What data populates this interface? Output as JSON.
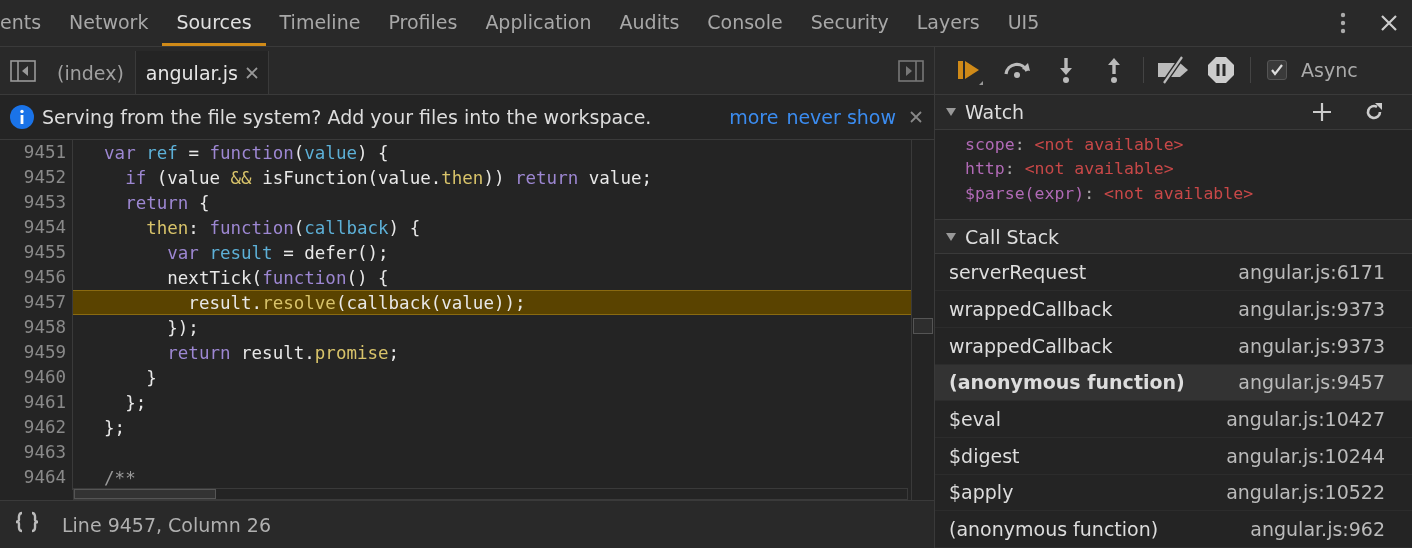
{
  "panel_tabs": [
    {
      "label": "ents",
      "selected": false
    },
    {
      "label": "Network",
      "selected": false
    },
    {
      "label": "Sources",
      "selected": true
    },
    {
      "label": "Timeline",
      "selected": false
    },
    {
      "label": "Profiles",
      "selected": false
    },
    {
      "label": "Application",
      "selected": false
    },
    {
      "label": "Audits",
      "selected": false
    },
    {
      "label": "Console",
      "selected": false
    },
    {
      "label": "Security",
      "selected": false
    },
    {
      "label": "Layers",
      "selected": false
    },
    {
      "label": "UI5",
      "selected": false
    }
  ],
  "file_tabs": [
    {
      "label": "(index)",
      "selected": false,
      "closable": false
    },
    {
      "label": "angular.js",
      "selected": true,
      "closable": true
    }
  ],
  "infobar": {
    "message": "Serving from the file system? Add your files into the workspace.",
    "links": [
      "more",
      "never show"
    ]
  },
  "code": [
    {
      "number": "9451",
      "current": false,
      "tokens": [
        {
          "keyword": "  var"
        },
        {
          "def": " ref"
        },
        {
          "plain": " = "
        },
        {
          "keyword": "function"
        },
        {
          "plain": "("
        },
        {
          "def": "value"
        },
        {
          "plain": ") {"
        }
      ]
    },
    {
      "number": "9452",
      "current": false,
      "tokens": [
        {
          "keyword": "    if"
        },
        {
          "plain": " (value "
        },
        {
          "property": "&&"
        },
        {
          "plain": " isFunction(value."
        },
        {
          "property": "then"
        },
        {
          "plain": ")) "
        },
        {
          "keyword": "return"
        },
        {
          "plain": " value;"
        }
      ]
    },
    {
      "number": "9453",
      "current": false,
      "tokens": [
        {
          "keyword": "    return"
        },
        {
          "plain": " {"
        }
      ]
    },
    {
      "number": "9454",
      "current": false,
      "tokens": [
        {
          "property": "      then"
        },
        {
          "plain": ": "
        },
        {
          "keyword": "function"
        },
        {
          "plain": "("
        },
        {
          "def": "callback"
        },
        {
          "plain": ") {"
        }
      ]
    },
    {
      "number": "9455",
      "current": false,
      "tokens": [
        {
          "keyword": "        var"
        },
        {
          "def": " result"
        },
        {
          "plain": " = defer();"
        }
      ]
    },
    {
      "number": "9456",
      "current": false,
      "tokens": [
        {
          "plain": "        nextTick("
        },
        {
          "keyword": "function"
        },
        {
          "plain": "() {"
        }
      ]
    },
    {
      "number": "9457",
      "current": true,
      "tokens": [
        {
          "plain": "          result."
        },
        {
          "property": "resolve"
        },
        {
          "plain": "(callback(value));"
        }
      ]
    },
    {
      "number": "9458",
      "current": false,
      "tokens": [
        {
          "plain": "        });"
        }
      ]
    },
    {
      "number": "9459",
      "current": false,
      "tokens": [
        {
          "keyword": "        return"
        },
        {
          "plain": " result."
        },
        {
          "property": "promise"
        },
        {
          "plain": ";"
        }
      ]
    },
    {
      "number": "9460",
      "current": false,
      "tokens": [
        {
          "plain": "      }"
        }
      ]
    },
    {
      "number": "9461",
      "current": false,
      "tokens": [
        {
          "plain": "    };"
        }
      ]
    },
    {
      "number": "9462",
      "current": false,
      "tokens": [
        {
          "plain": "  };"
        }
      ]
    },
    {
      "number": "9463",
      "current": false
    },
    {
      "number": "9464",
      "current": false,
      "tokens": [
        {
          "comment": "  /**"
        }
      ]
    }
  ],
  "status_bar": {
    "position": "Line 9457, Column 26"
  },
  "debugger": {
    "async": {
      "label": "Async",
      "checked": true
    }
  },
  "watch": {
    "title": "Watch",
    "expanded": true,
    "items": [
      {
        "name": "scope",
        "separator": ":",
        "value": "<not available>"
      },
      {
        "name": "http",
        "separator": ":",
        "value": "<not available>"
      },
      {
        "name": "$parse(expr)",
        "separator": ":",
        "value": "<not available>"
      }
    ]
  },
  "call_stack": {
    "title": "Call Stack",
    "expanded": true,
    "frames": [
      {
        "name": "serverRequest",
        "location": "angular.js:6171",
        "selected": false
      },
      {
        "name": "wrappedCallback",
        "location": "angular.js:9373",
        "selected": false
      },
      {
        "name": "wrappedCallback",
        "location": "angular.js:9373",
        "selected": false
      },
      {
        "name": "(anonymous function)",
        "location": "angular.js:9457",
        "selected": true
      },
      {
        "name": "$eval",
        "location": "angular.js:10427",
        "selected": false
      },
      {
        "name": "$digest",
        "location": "angular.js:10244",
        "selected": false
      },
      {
        "name": "$apply",
        "location": "angular.js:10522",
        "selected": false
      },
      {
        "name": "(anonymous function)",
        "location": "angular.js:962",
        "selected": false
      }
    ]
  }
}
